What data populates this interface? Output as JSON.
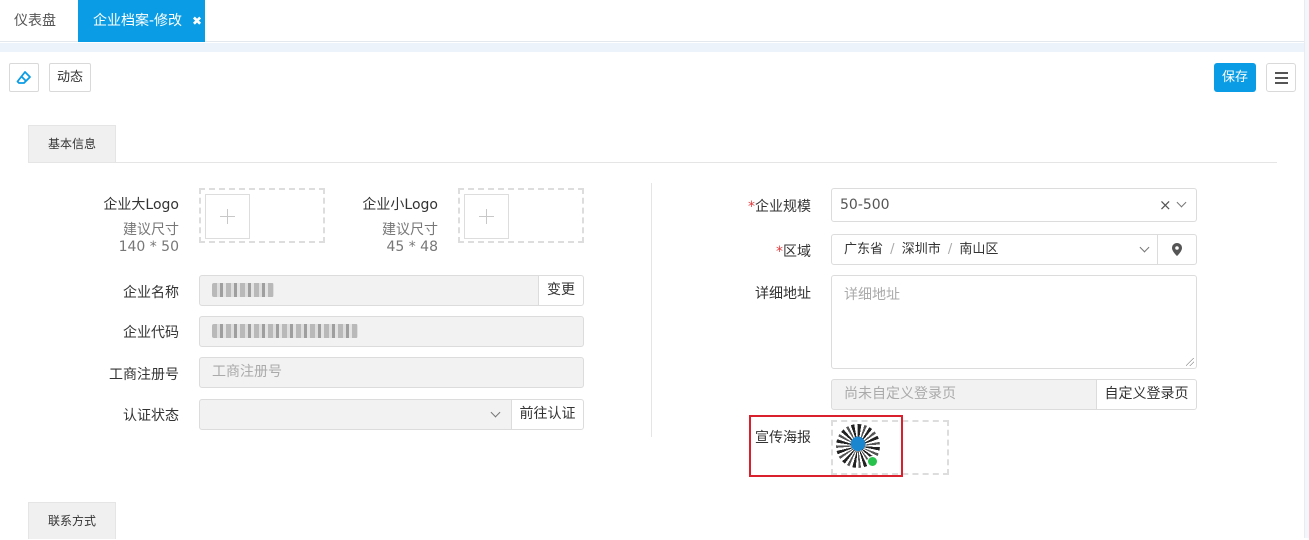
{
  "tabs": {
    "dashboard": "仪表盘",
    "active": "企业档案-修改",
    "close_glyph": "✖"
  },
  "toolbar": {
    "dynamic": "动态",
    "save": "保存"
  },
  "sections": {
    "basic": "基本信息",
    "contact": "联系方式"
  },
  "left_form": {
    "big_logo_label": "企业大Logo",
    "big_logo_hint": "建议尺寸",
    "big_logo_size": "140 * 50",
    "small_logo_label": "企业小Logo",
    "small_logo_hint": "建议尺寸",
    "small_logo_size": "45 * 48",
    "name_label": "企业名称",
    "name_change": "变更",
    "code_label": "企业代码",
    "reg_label": "工商注册号",
    "reg_placeholder": "工商注册号",
    "cert_label": "认证状态",
    "cert_button": "前往认证"
  },
  "right_form": {
    "scale_req": "*",
    "scale_label": "企业规模",
    "scale_value": "50-500",
    "scale_clear": "×",
    "region_req": "*",
    "region_label": "区域",
    "region_province": "广东省",
    "region_city": "深圳市",
    "region_district": "南山区",
    "region_sep": "/",
    "address_label": "详细地址",
    "address_placeholder": "详细地址",
    "login_placeholder": "尚未自定义登录页",
    "login_button": "自定义登录页",
    "poster_label": "宣传海报"
  },
  "colors": {
    "accent": "#0a9de6",
    "required": "#e4393c",
    "highlight": "#d9202c"
  }
}
